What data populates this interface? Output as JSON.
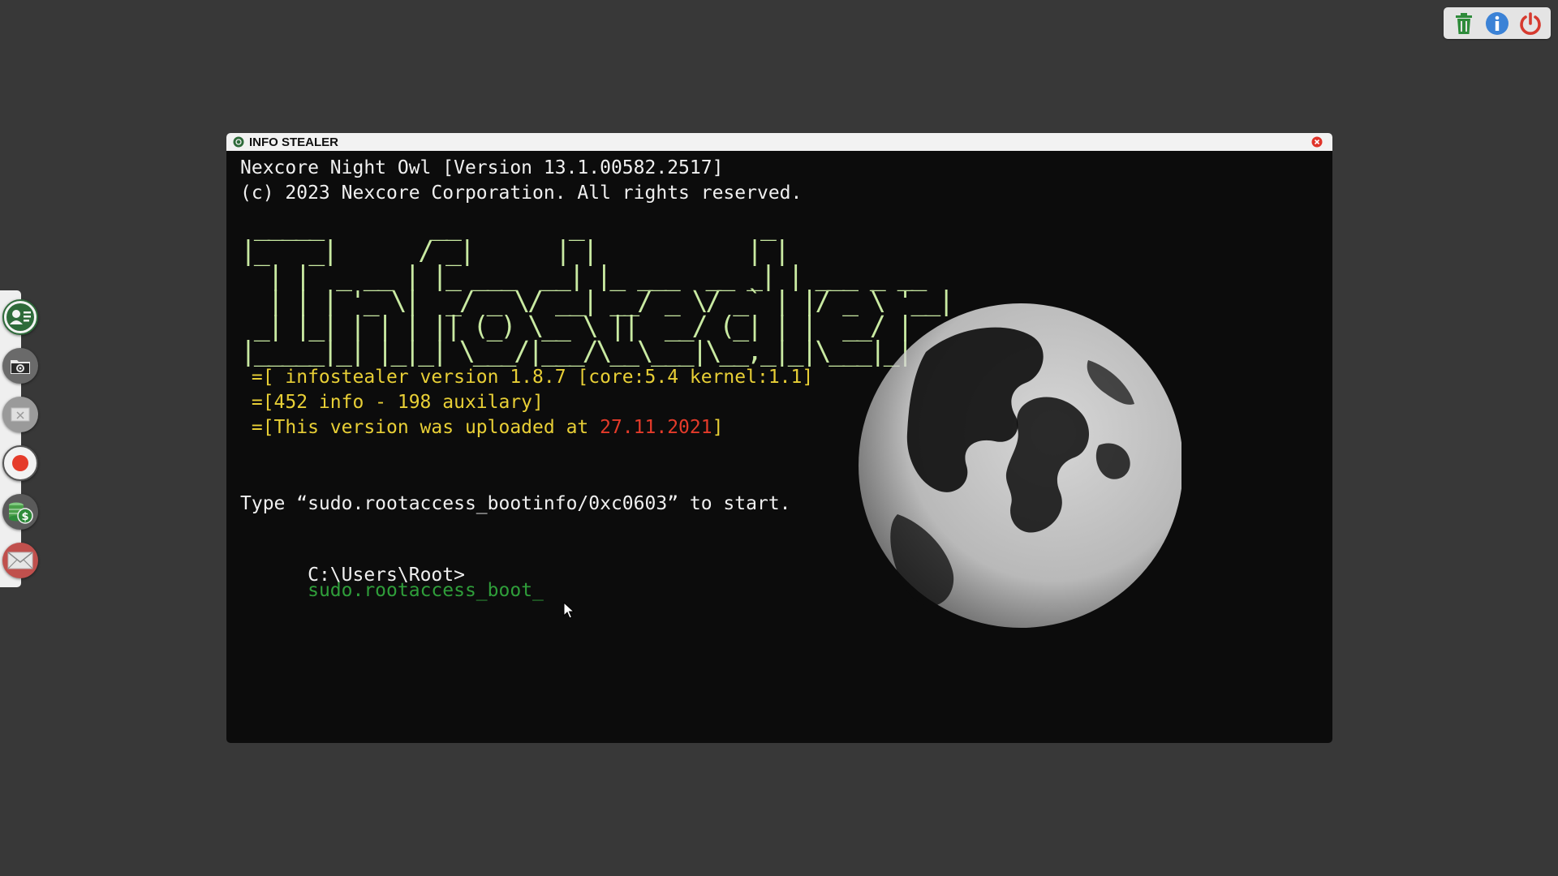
{
  "tray": {
    "items": [
      {
        "name": "trash-icon",
        "color": "#2e8b3a"
      },
      {
        "name": "info-icon",
        "color": "#3b82d6"
      },
      {
        "name": "power-icon",
        "color": "#d63a2f"
      }
    ]
  },
  "dock": {
    "items": [
      {
        "name": "contacts-icon",
        "color": "#2e6b3a"
      },
      {
        "name": "folder-icon",
        "color": "#555555"
      },
      {
        "name": "window-icon",
        "color": "#bdbdbd"
      },
      {
        "name": "record-icon",
        "color": "#e53b2a"
      },
      {
        "name": "money-icon",
        "color": "#2e8b3a"
      },
      {
        "name": "mail-icon",
        "color": "#c0504d"
      }
    ]
  },
  "window": {
    "title": "INFO STEALER"
  },
  "terminal": {
    "header_line1": "Nexcore Night Owl [Version 13.1.00582.2517]",
    "header_line2": "(c) 2023 Nexcore Corporation. All rights reserved.",
    "ascii_banner": " _____        __        _             _\n|_   _|      / _|      | |           | |\n  | |  _ __ | |_ ___  __| |_ ___  __ _| | ___ _ __\n  | | | '_ \\|  _/ _ \\/ __| __/ _ \\/ _` | |/ _ \\ '__|\n _| |_| | | | || (_) \\__ \\ ||  __/ (_| | |  __/ |\n|_____|_| |_|_| \\___/|___/\\__\\___|\\__,_|_|\\___|_|",
    "info_line1": " =[ infostealer version 1.8.7 [core:5.4 kernel:1.1]",
    "info_line2": " =[452 info - 198 auxilary]",
    "info_line3_prefix": " =[This version was uploaded at ",
    "info_line3_date": "27.11.2021",
    "info_line3_suffix": "]",
    "instruction": "Type “sudo.rootaccess_bootinfo/0xc0603” to start.",
    "prompt": "C:\\Users\\Root>",
    "typed_command": "sudo.rootaccess_boot_"
  }
}
